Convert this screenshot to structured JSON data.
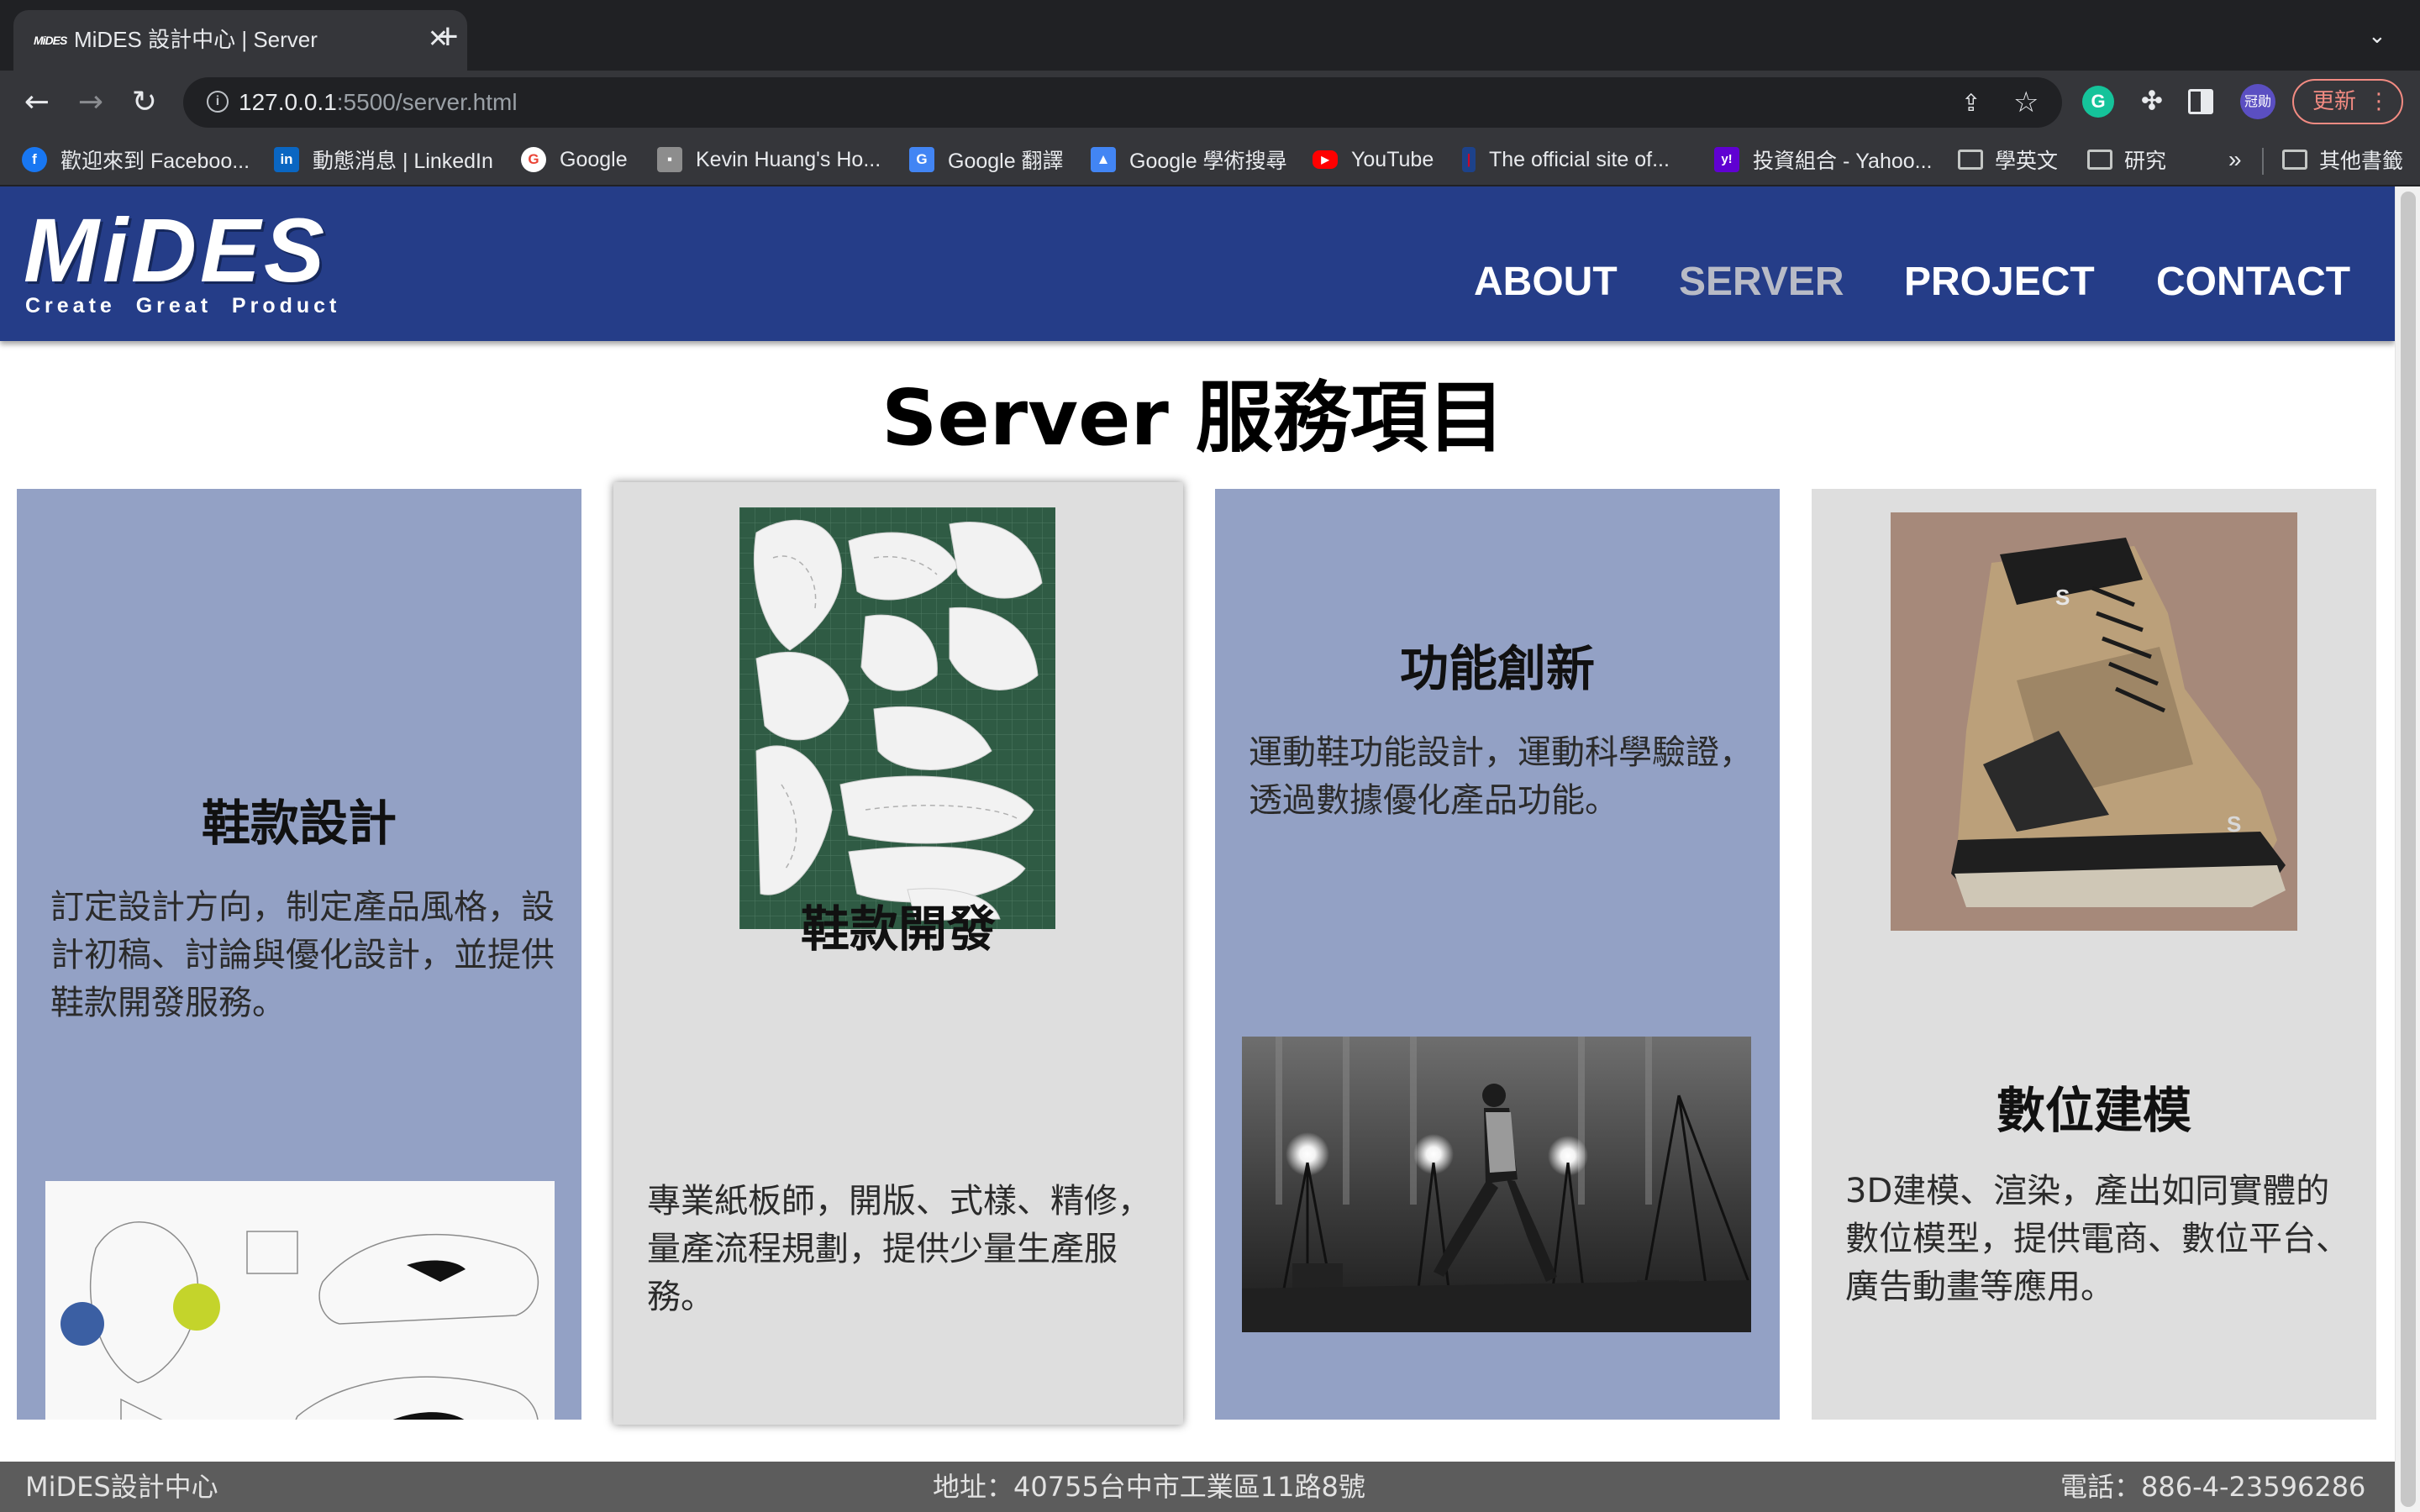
{
  "browser": {
    "tab_title": "MiDES 設計中心 | Server",
    "tab_favicon": "MiDES",
    "url_host": "127.0.0.1",
    "url_rest": ":5500/server.html",
    "update_label": "更新",
    "profile_label": "冠勛",
    "bookmarks": [
      {
        "label": "歡迎來到 Faceboo...",
        "icon": "facebook-icon",
        "color": "#1877f2",
        "glyph": "f"
      },
      {
        "label": "動態消息 | LinkedIn",
        "icon": "linkedin-icon",
        "color": "#0a66c2",
        "glyph": "in"
      },
      {
        "label": "Google",
        "icon": "google-icon",
        "color": "#ffffff",
        "glyph": "G"
      },
      {
        "label": "Kevin Huang's Ho...",
        "icon": "page-icon",
        "color": "#8d8d8d",
        "glyph": "▪"
      },
      {
        "label": "Google 翻譯",
        "icon": "translate-icon",
        "color": "#4285f4",
        "glyph": "G"
      },
      {
        "label": "Google 學術搜尋",
        "icon": "scholar-icon",
        "color": "#4285f4",
        "glyph": "▲"
      },
      {
        "label": "YouTube",
        "icon": "youtube-icon",
        "color": "#ff0000",
        "glyph": "▶"
      },
      {
        "label": "The official site of...",
        "icon": "nba-icon",
        "color": "#c9082a",
        "glyph": "|"
      },
      {
        "label": "投資組合 - Yahoo...",
        "icon": "yahoo-icon",
        "color": "#6001d2",
        "glyph": "y!"
      },
      {
        "label": "學英文",
        "icon": "folder-icon",
        "color": "",
        "glyph": ""
      },
      {
        "label": "研究",
        "icon": "folder-icon",
        "color": "",
        "glyph": ""
      }
    ],
    "bookmarks_overflow": "»",
    "other_bookmarks": "其他書籤"
  },
  "site": {
    "logo": "MiDES",
    "tagline": "Create  Great  Product",
    "nav": [
      {
        "label": "ABOUT",
        "active": false
      },
      {
        "label": "SERVER",
        "active": true
      },
      {
        "label": "PROJECT",
        "active": false
      },
      {
        "label": "CONTACT",
        "active": false
      }
    ],
    "title": "Server 服務項目",
    "cards": [
      {
        "heading": "鞋款設計",
        "text": "訂定設計方向，制定產品風格，設計初稿、討論與優化設計，並提供鞋款開發服務。"
      },
      {
        "heading": "鞋款開發",
        "text": "專業紙板師，開版、式樣、精修，量產流程規劃，提供少量生產服務。"
      },
      {
        "heading": "功能創新",
        "text": "運動鞋功能設計，運動科學驗證，透過數據優化產品功能。"
      },
      {
        "heading": "數位建模",
        "text": "3D建模、渲染，產出如同實體的數位模型，提供電商、數位平台、廣告動畫等應用。"
      }
    ],
    "footer": {
      "name": "MiDES設計中心",
      "address": "地址：40755台中市工業區11路8號",
      "phone": "電話：886-4-23596286"
    }
  },
  "colors": {
    "header_bg": "#253d88",
    "card_blue": "#93a1c5",
    "card_grey": "#dedede",
    "footer_bg": "#5c5c5c"
  }
}
